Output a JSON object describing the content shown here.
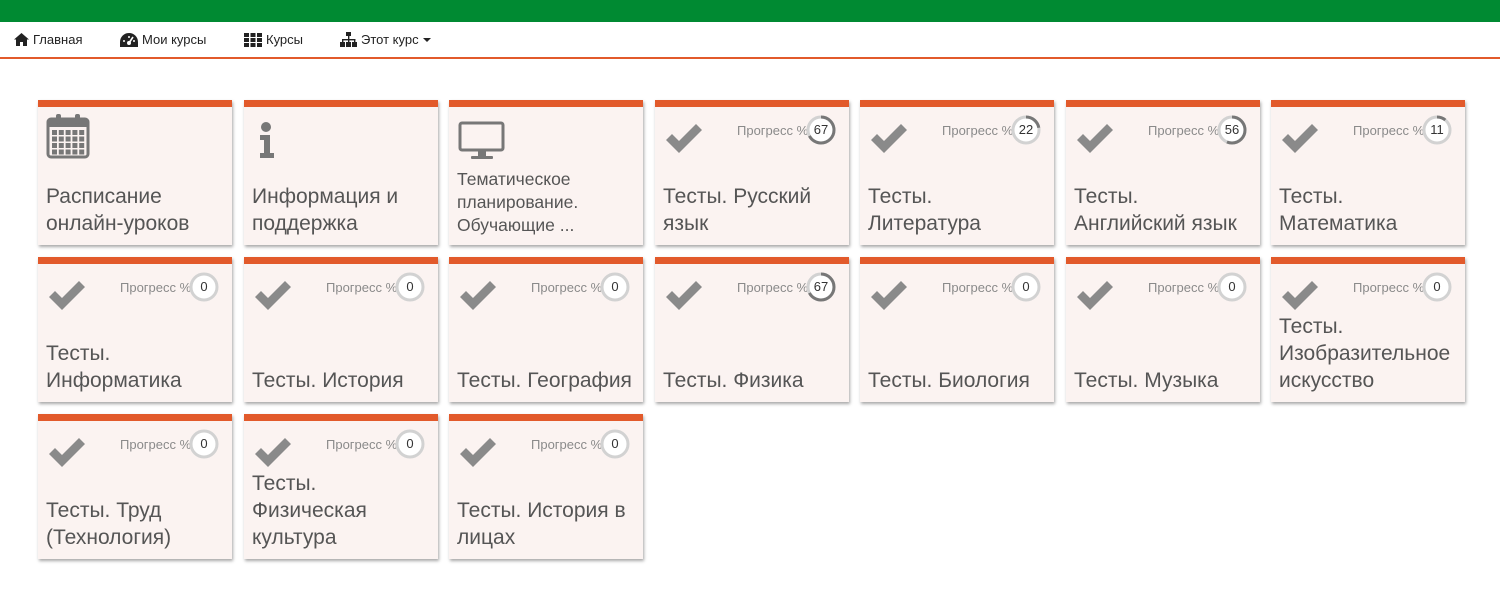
{
  "nav": {
    "home_label": "Главная",
    "my_courses_label": "Мои курсы",
    "courses_label": "Курсы",
    "this_course_label": "Этот курс"
  },
  "colors": {
    "top_bar": "#008a32",
    "accent": "#e25a2b",
    "tile_bg": "#fbf3f1"
  },
  "progress_label": "Прогресс %",
  "tiles": [
    {
      "title": "Расписание онлайн-уроков",
      "icon": "calendar-icon"
    },
    {
      "title": "Информация и поддержка",
      "icon": "info-icon"
    },
    {
      "title": "Тематическое планирование. Обучающие ...",
      "icon": "monitor-icon"
    },
    {
      "title": "Тесты. Русский язык",
      "icon": "check-icon",
      "progress": 67
    },
    {
      "title": "Тесты. Литература",
      "icon": "check-icon",
      "progress": 22
    },
    {
      "title": "Тесты. Английский язык",
      "icon": "check-icon",
      "progress": 56
    },
    {
      "title": "Тесты. Математика",
      "icon": "check-icon",
      "progress": 11
    },
    {
      "title": "Тесты. Информатика",
      "icon": "check-icon",
      "progress": 0
    },
    {
      "title": "Тесты. История",
      "icon": "check-icon",
      "progress": 0
    },
    {
      "title": "Тесты. География",
      "icon": "check-icon",
      "progress": 0
    },
    {
      "title": "Тесты. Физика",
      "icon": "check-icon",
      "progress": 67
    },
    {
      "title": "Тесты. Биология",
      "icon": "check-icon",
      "progress": 0
    },
    {
      "title": "Тесты. Музыка",
      "icon": "check-icon",
      "progress": 0
    },
    {
      "title": "Тесты. Изобразительное искусство",
      "icon": "check-icon",
      "progress": 0
    },
    {
      "title": "Тесты. Труд (Технология)",
      "icon": "check-icon",
      "progress": 0
    },
    {
      "title": "Тесты. Физическая культура",
      "icon": "check-icon",
      "progress": 0
    },
    {
      "title": "Тесты. История в лицах",
      "icon": "check-icon",
      "progress": 0
    }
  ]
}
